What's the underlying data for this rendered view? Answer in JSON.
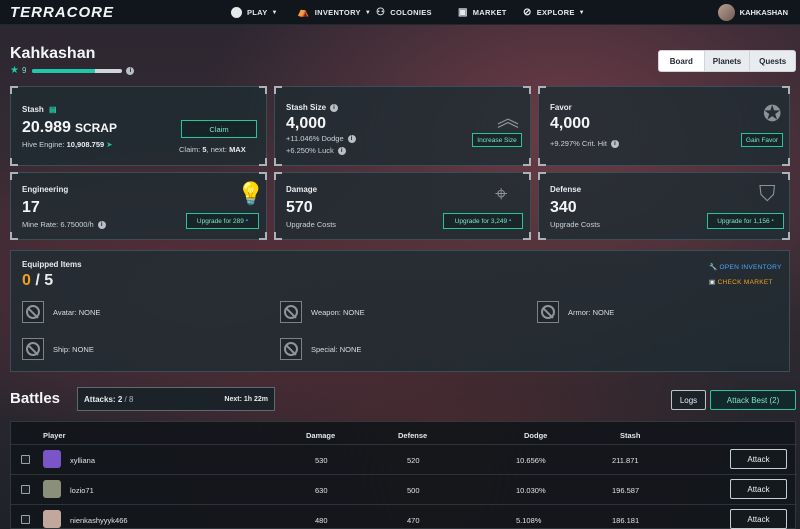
{
  "nav": {
    "logo": "TERRACORE",
    "play": "PLAY",
    "inventory": "INVENTORY",
    "colonies": "COLONIES",
    "market": "MARKET",
    "explore": "EXPLORE",
    "username": "KAHKASHAN"
  },
  "profile": {
    "name": "Kahkashan",
    "level": "9",
    "xp_fraction": 0.7
  },
  "tabs": [
    "Board",
    "Planets",
    "Quests"
  ],
  "stash": {
    "label": "Stash",
    "value": "20.989",
    "unit": "SCRAP",
    "hive_label": "Hive Engine:",
    "hive_value": "10,908.759",
    "claim_button": "Claim",
    "claim_label": "Claim:",
    "claim_value": "5",
    "next_label": ", next:",
    "next_value": "MAX"
  },
  "stash_size": {
    "label": "Stash Size",
    "value": "4,000",
    "dodge": "+11.046% Dodge",
    "luck": "+6.250% Luck",
    "button": "Increase Size"
  },
  "favor": {
    "label": "Favor",
    "value": "4,000",
    "crit": "+9.297% Crit. Hit",
    "button": "Gain Favor"
  },
  "engineering": {
    "label": "Engineering",
    "value": "17",
    "rate": "Mine Rate: 6.75000/h",
    "button": "Upgrade for 289"
  },
  "damage": {
    "label": "Damage",
    "value": "570",
    "sub": "Upgrade Costs",
    "button": "Upgrade for 3,249"
  },
  "defense": {
    "label": "Defense",
    "value": "340",
    "sub": "Upgrade Costs",
    "button": "Upgrade for 1,156"
  },
  "equipped": {
    "label": "Equipped Items",
    "count": "0",
    "total": "/ 5",
    "open_inventory": "OPEN INVENTORY",
    "check_market": "CHECK MARKET",
    "slots": {
      "avatar": "Avatar: NONE",
      "weapon": "Weapon: NONE",
      "armor": "Armor: NONE",
      "ship": "Ship: NONE",
      "special": "Special: NONE"
    }
  },
  "battles": {
    "title": "Battles",
    "attacks_label": "Attacks:",
    "attacks_value": "2",
    "attacks_max": "/ 8",
    "next_label": "Next:",
    "next_value": "1h 22m",
    "logs_button": "Logs",
    "attack_best_button": "Attack Best (2)",
    "columns": [
      "Player",
      "Damage",
      "Defense",
      "Dodge",
      "Stash"
    ],
    "rows": [
      {
        "player": "xylliana",
        "damage": "530",
        "defense": "520",
        "dodge": "10.656%",
        "stash": "211.871",
        "action": "Attack",
        "avatar_color": "#7a55c8"
      },
      {
        "player": "lozio71",
        "damage": "630",
        "defense": "500",
        "dodge": "10.030%",
        "stash": "196.587",
        "action": "Attack",
        "avatar_color": "#8a8f7a"
      },
      {
        "player": "nienkashyyyk466",
        "damage": "480",
        "defense": "470",
        "dodge": "5.108%",
        "stash": "186.181",
        "action": "Attack",
        "avatar_color": "#c2a89a"
      }
    ]
  },
  "colors": {
    "accent": "#27c4a0",
    "warning": "#f0a020",
    "background": "#10161b"
  }
}
